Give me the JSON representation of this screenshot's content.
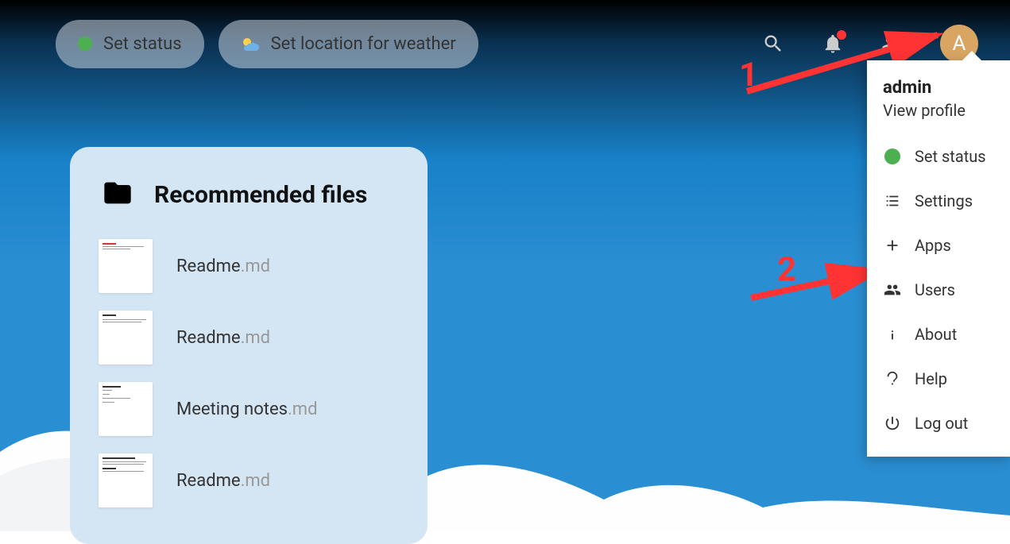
{
  "topbar": {
    "status_label": "Set status",
    "weather_label": "Set location for weather"
  },
  "avatar": {
    "letter": "A"
  },
  "dropdown": {
    "username": "admin",
    "view_profile": "View profile",
    "items": [
      {
        "label": "Set status",
        "icon": "status"
      },
      {
        "label": "Settings",
        "icon": "settings-list"
      },
      {
        "label": "Apps",
        "icon": "plus"
      },
      {
        "label": "Users",
        "icon": "users"
      },
      {
        "label": "About",
        "icon": "info"
      },
      {
        "label": "Help",
        "icon": "question"
      },
      {
        "label": "Log out",
        "icon": "power"
      }
    ]
  },
  "card": {
    "title": "Recommended files",
    "files": [
      {
        "name": "Readme",
        "ext": ".md"
      },
      {
        "name": "Readme",
        "ext": ".md"
      },
      {
        "name": "Meeting notes",
        "ext": ".md"
      },
      {
        "name": "Readme",
        "ext": ".md"
      }
    ]
  },
  "annotations": {
    "one": "1",
    "two": "2"
  }
}
